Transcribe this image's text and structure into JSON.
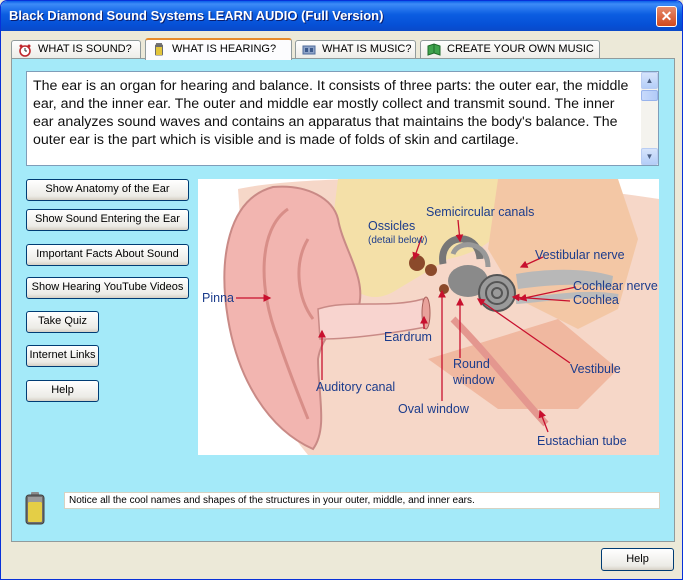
{
  "window": {
    "title": "Black Diamond Sound Systems LEARN AUDIO (Full Version)",
    "close_label": "✕"
  },
  "tabs": [
    {
      "label": "WHAT IS SOUND?",
      "icon": "alarm-clock-icon"
    },
    {
      "label": "WHAT IS HEARING?",
      "icon": "battery-icon"
    },
    {
      "label": "WHAT IS MUSIC?",
      "icon": "speaker-icon"
    },
    {
      "label": "CREATE YOUR OWN MUSIC",
      "icon": "book-icon"
    }
  ],
  "active_tab": "WHAT IS HEARING?",
  "description": "The ear is an organ for hearing and balance. It consists of three parts: the outer ear, the middle ear, and the inner ear. The outer and middle ear mostly collect and transmit sound. The inner ear analyzes sound waves and contains an apparatus that maintains the body's balance. The outer ear is the part which is visible and is made of folds of skin and cartilage.",
  "buttons": [
    {
      "label": "Show Anatomy of the Ear"
    },
    {
      "label": "Show Sound Entering the Ear"
    },
    {
      "label": "Important Facts About Sound"
    },
    {
      "label": "Show Hearing YouTube Videos"
    },
    {
      "label": "Take Quiz"
    },
    {
      "label": "Internet Links"
    },
    {
      "label": "Help"
    }
  ],
  "diagram_labels": {
    "semicircular": "Semicircular canals",
    "ossicles": "Ossicles",
    "ossicles_note": "(detail below)",
    "vestibular_nerve": "Vestibular nerve",
    "cochlear_nerve": "Cochlear nerve",
    "cochlea": "Cochlea",
    "pinna": "Pinna",
    "eardrum": "Eardrum",
    "round_window_1": "Round",
    "round_window_2": "window",
    "vestibule": "Vestibule",
    "auditory_canal": "Auditory canal",
    "oval_window": "Oval window",
    "eustachian_tube": "Eustachian tube"
  },
  "status_text": "Notice all the cool names and shapes of the structures in your outer, middle, and inner ears.",
  "bottom_help_label": "Help",
  "colors": {
    "panel_bg": "#A4EAF9",
    "title_bar": "#0A5FE8",
    "label_text": "#1C3C8C",
    "arrow": "#C8102E"
  }
}
